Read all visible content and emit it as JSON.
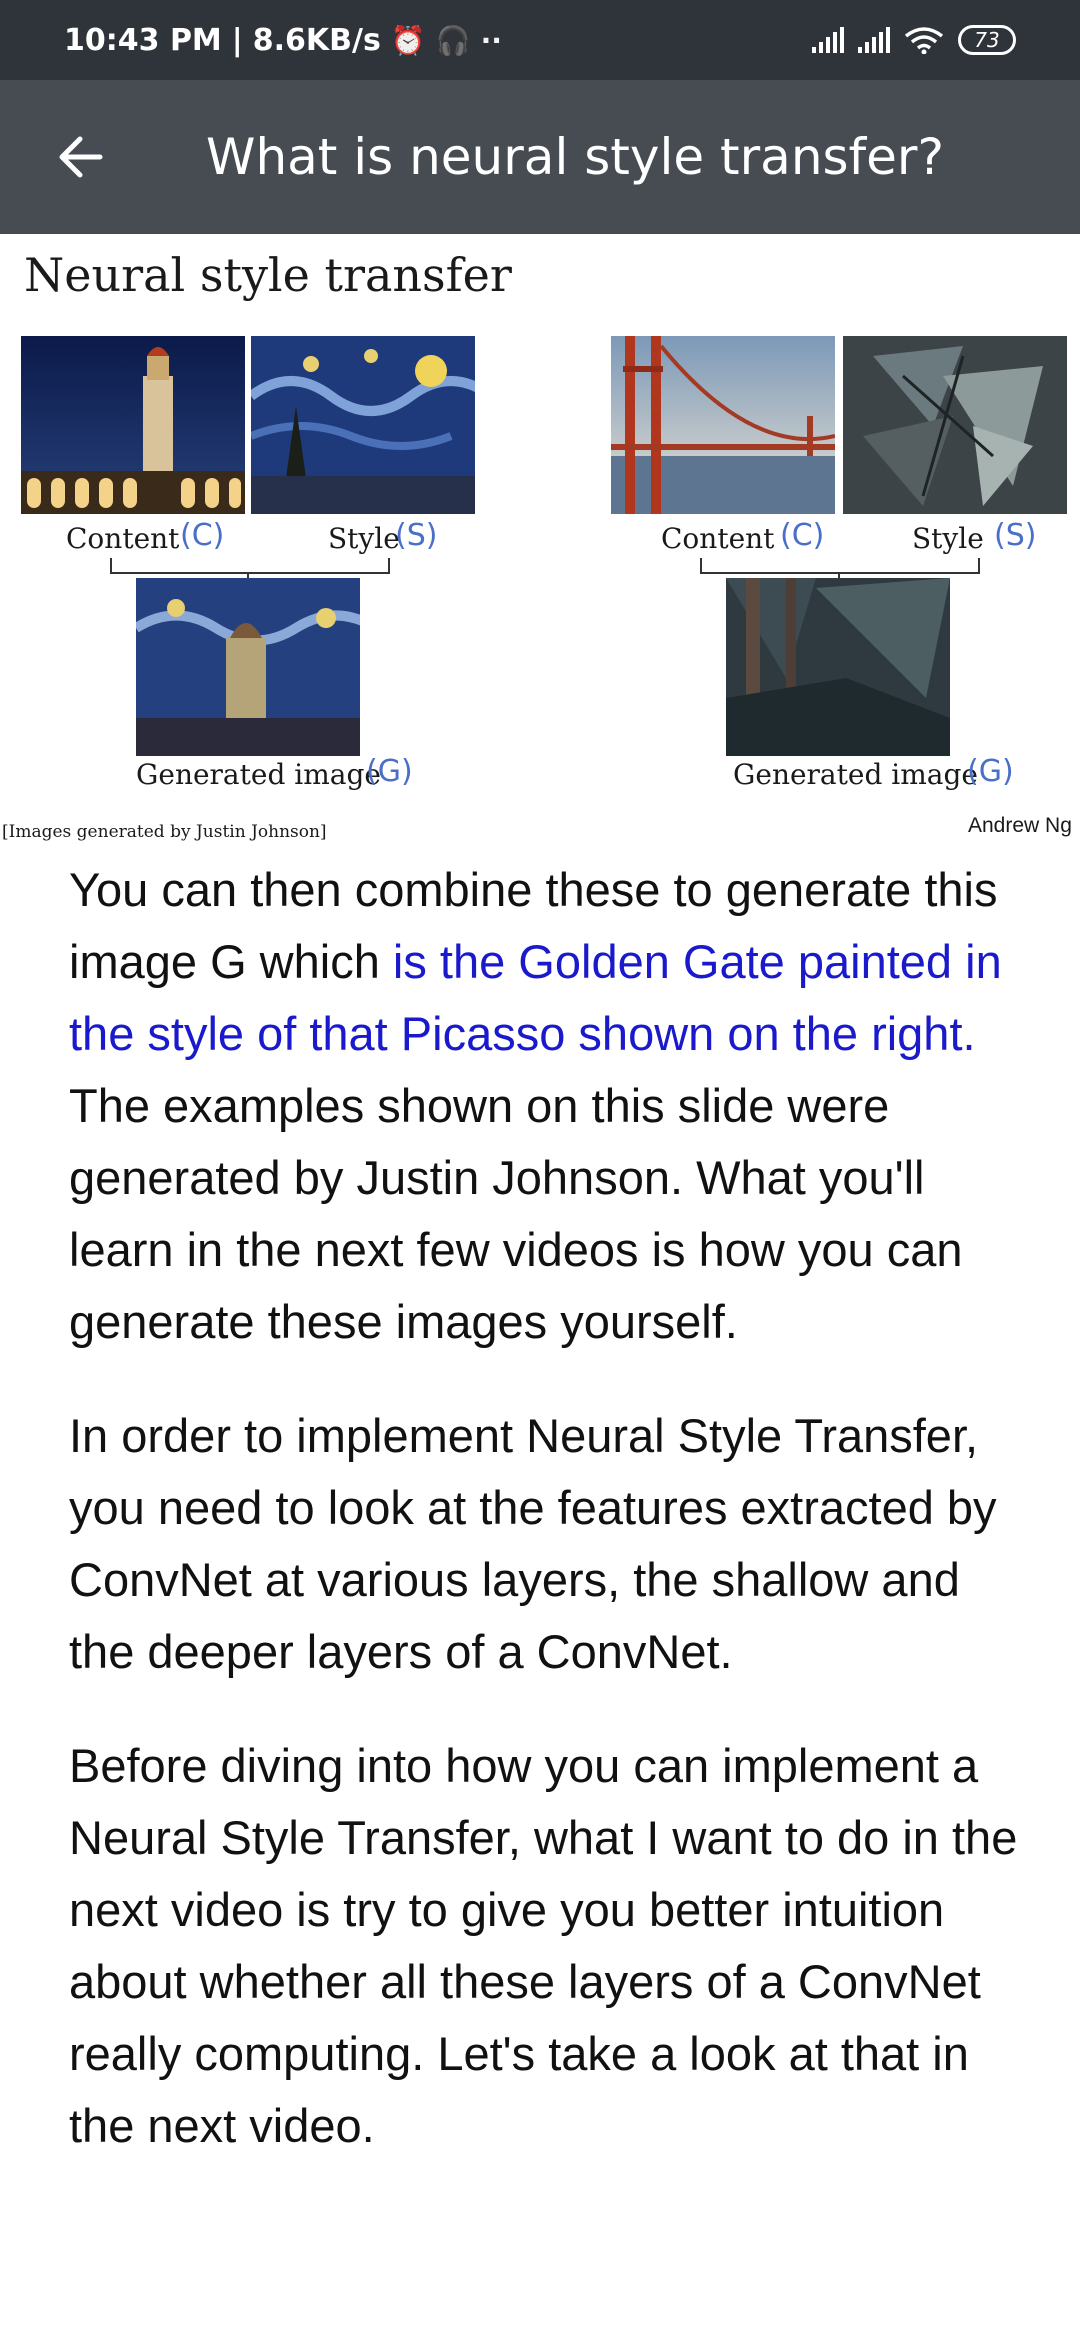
{
  "status_bar": {
    "time": "10:43 PM",
    "network_speed": "8.6KB/s",
    "battery_level": "73",
    "icons": [
      "alarm-off-icon",
      "headset-icon",
      "more-dots-icon",
      "signal-icon",
      "signal-icon",
      "wifi-icon",
      "battery-icon"
    ]
  },
  "app_bar": {
    "back_icon": "arrow-left-icon",
    "title": "What is neural style transfer?"
  },
  "slide": {
    "title": "Neural style transfer",
    "left_example": {
      "content_label": "Content",
      "content_note": "(C)",
      "style_label": "Style",
      "style_note": "(S)",
      "generated_label": "Generated image",
      "generated_note": "(G)"
    },
    "right_example": {
      "content_label": "Content",
      "content_note": "(C)",
      "style_label": "Style",
      "style_note": "(S)",
      "generated_label": "Generated image",
      "generated_note": "(G)"
    },
    "credit_left": "[Images generated by Justin Johnson]",
    "credit_right": "Andrew Ng"
  },
  "article": {
    "p1_a": "You can then combine these to generate this image G which ",
    "p1_link": "is the Golden Gate painted in the style of that Picasso shown on the right.",
    "p1_b": " The examples shown on this slide were generated by Justin Johnson. What you'll learn in the next few videos is how you can generate these images yourself.",
    "p2": "In order to implement Neural Style Transfer, you need to look at the features extracted by ConvNet at various layers, the shallow and the deeper layers of a ConvNet.",
    "p3": "Before diving into how you can implement a Neural Style Transfer, what I want to do in the next video is try to give you better intuition about whether all these layers of a ConvNet really computing. Let's take a look at that in the next video."
  },
  "colors": {
    "status_bar_bg": "#2f343a",
    "app_bar_bg": "#474c52",
    "link_text": "#1a1acc",
    "handwriting": "#4a6fc8"
  }
}
